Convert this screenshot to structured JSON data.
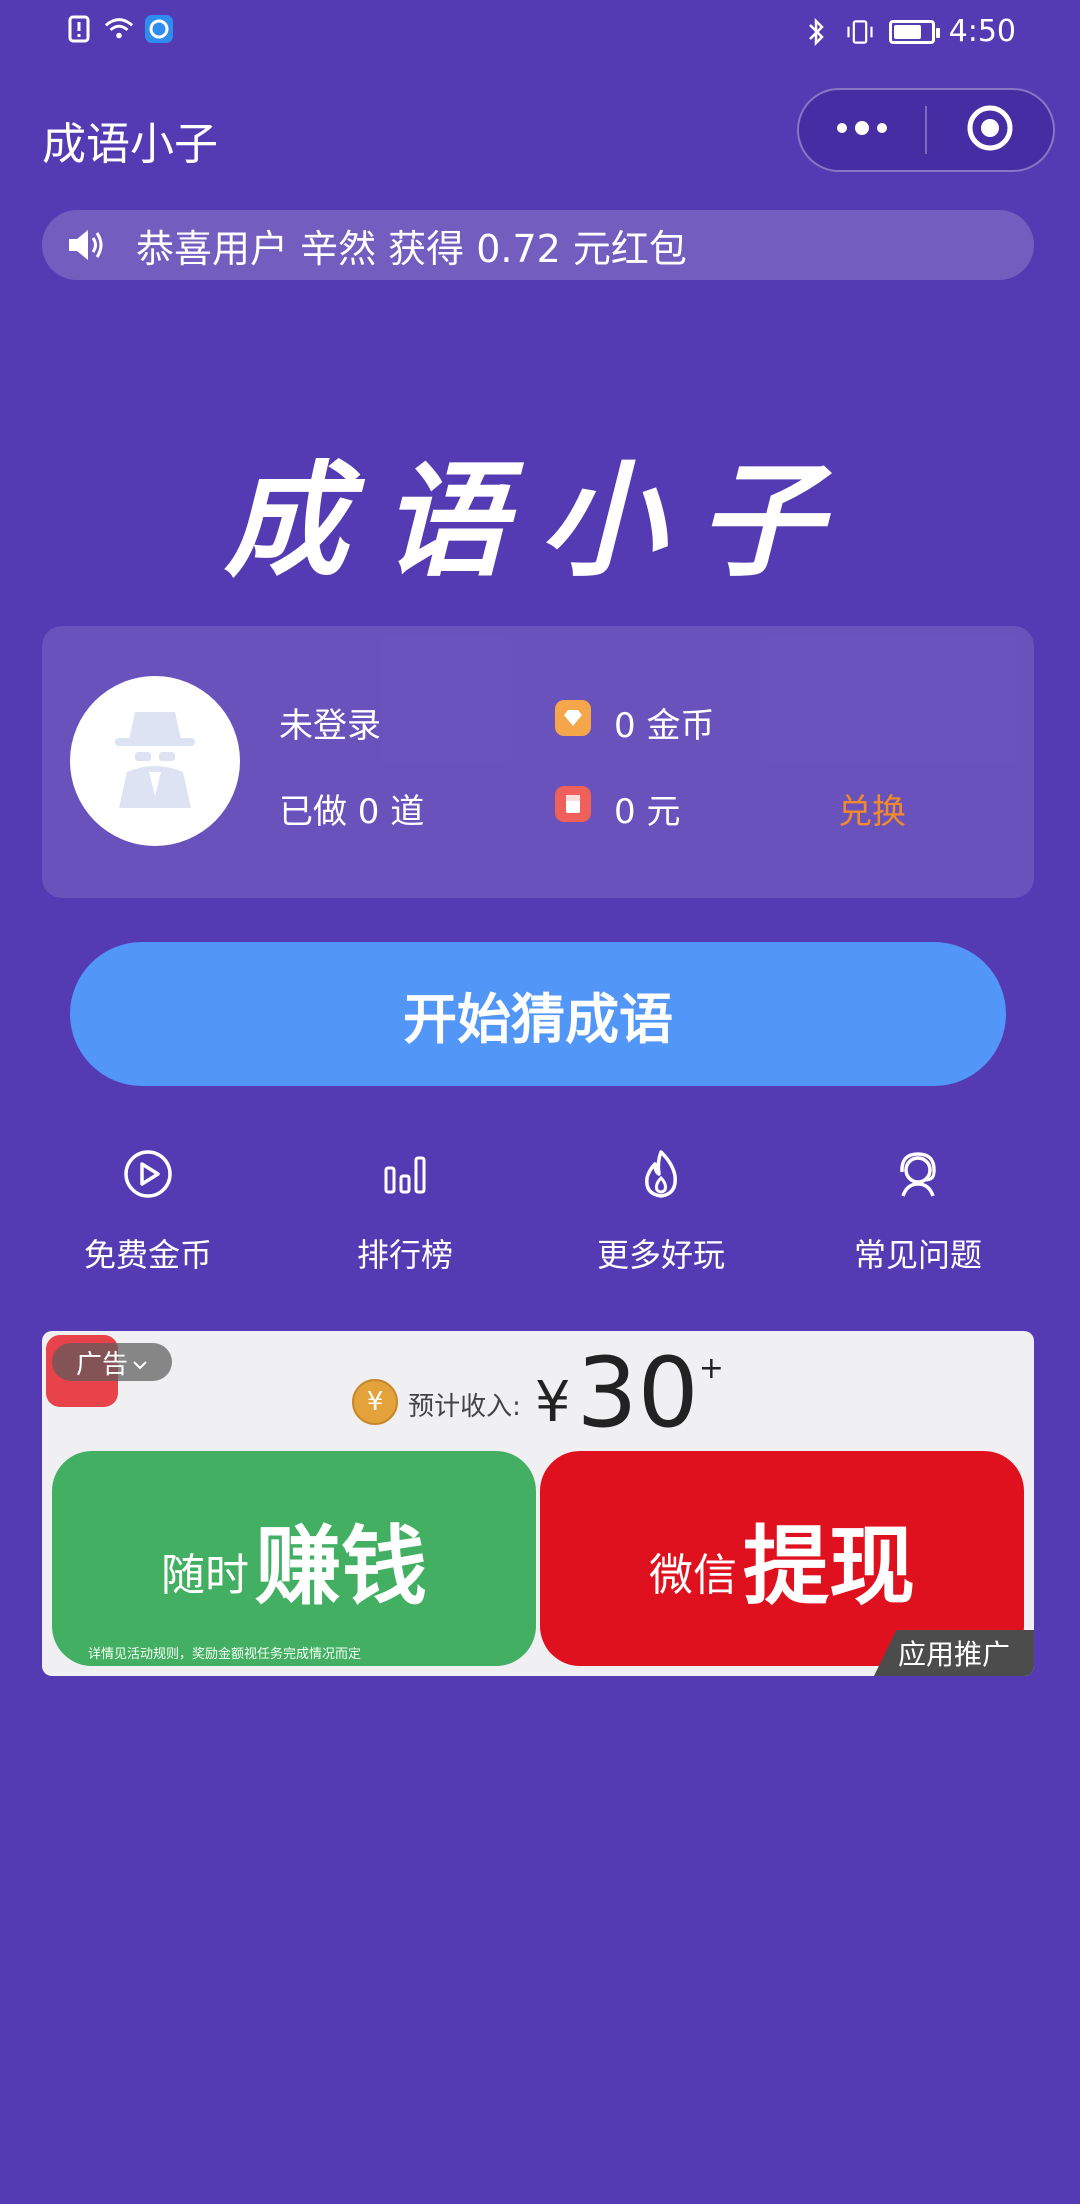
{
  "status_bar": {
    "time": "4:50",
    "icons": [
      "alert-icon",
      "wifi-icon",
      "app-notification-icon",
      "bluetooth-icon",
      "vibrate-icon",
      "battery-icon"
    ],
    "battery_level": 0.75
  },
  "nav": {
    "title": "成语小子",
    "more_icon": "more-dots-icon",
    "close_icon": "target-circle-icon"
  },
  "marquee": {
    "icon": "speaker-icon",
    "text": "恭喜用户 辛然 获得 0.72 元红包"
  },
  "logo": {
    "text": "成语小子"
  },
  "user_card": {
    "avatar_icon": "incognito-user-icon",
    "login_status": "未登录",
    "done_count": "已做 0 道",
    "coins": "0 金币",
    "money": "0 元",
    "exchange_label": "兑换",
    "colors": {
      "coin_icon": "#F5A54A",
      "money_icon": "#F0605A",
      "exchange": "#F08A2C"
    }
  },
  "start_button": {
    "label": "开始猜成语",
    "color": "#5296F7"
  },
  "features": [
    {
      "label": "免费金币",
      "icon": "play-circle-icon"
    },
    {
      "label": "排行榜",
      "icon": "bar-chart-icon"
    },
    {
      "label": "更多好玩",
      "icon": "flame-icon"
    },
    {
      "label": "常见问题",
      "icon": "headset-support-icon"
    }
  ],
  "ad": {
    "tag": "广告",
    "income_label": "预计收入:",
    "currency": "¥",
    "amount": "30",
    "plus": "+",
    "left_small": "随时",
    "left_big": "赚钱",
    "right_small": "微信",
    "right_big": "提现",
    "footnote": "详情见活动规则，奖励金额视任务完成情况而定",
    "promo_label": "应用推广"
  },
  "colors": {
    "background": "#553BB3"
  }
}
